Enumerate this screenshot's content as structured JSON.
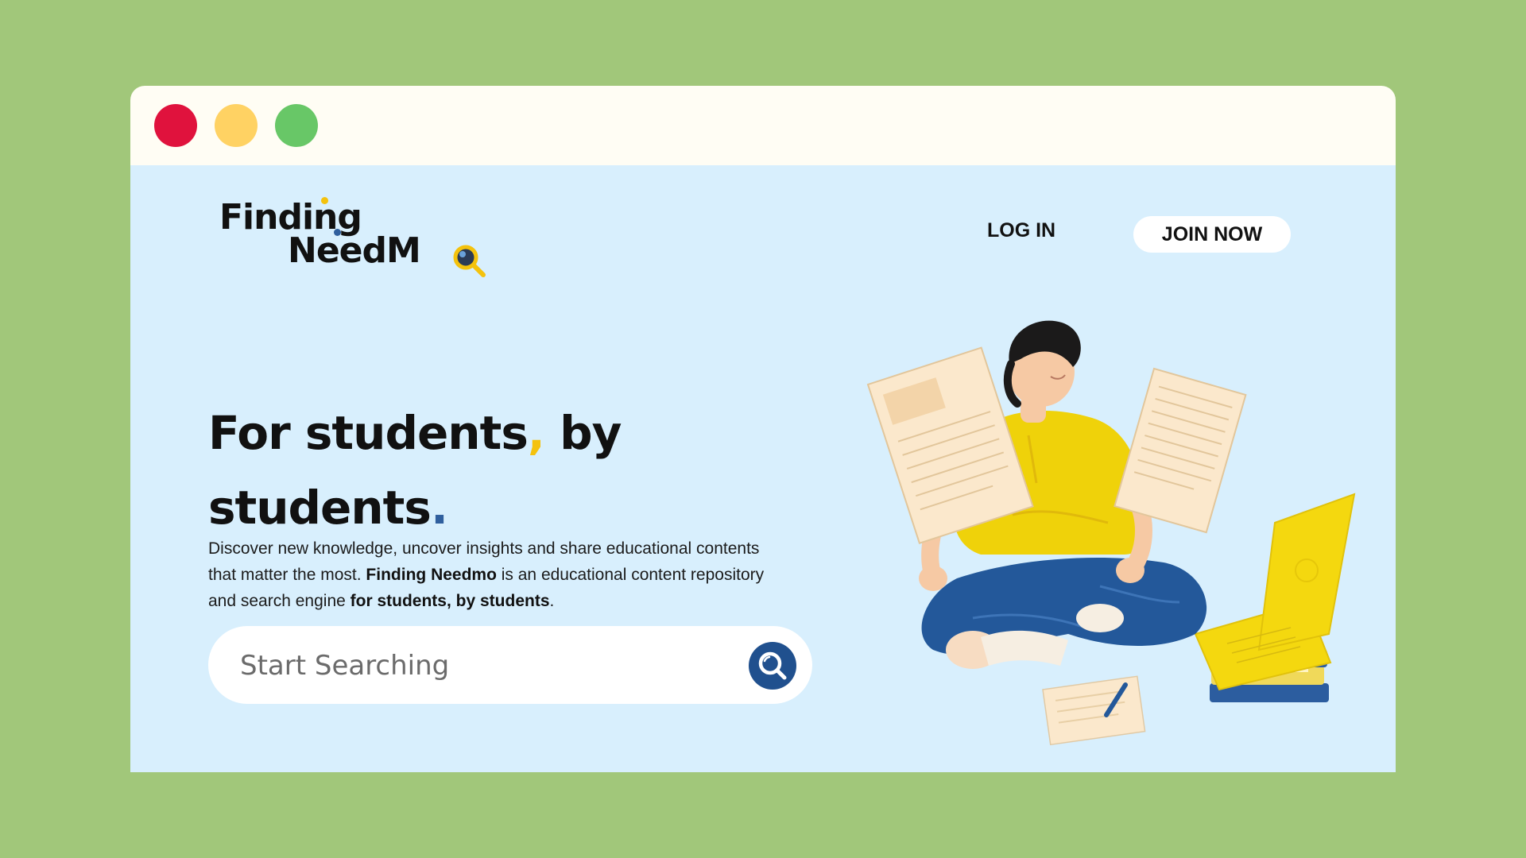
{
  "window": {
    "controls": [
      "close",
      "minimize",
      "maximize"
    ],
    "colors": {
      "close": "#e0123d",
      "minimize": "#ffd263",
      "maximize": "#68c767",
      "titlebar": "#fffdf4",
      "content_bg": "#d8effd",
      "page_bg": "#a1c77a"
    }
  },
  "header": {
    "logo": {
      "line1": "Finding",
      "line2": "NeedM",
      "icon": "magnifier-o-icon"
    },
    "nav": {
      "login": "LOG IN",
      "join": "JOIN NOW"
    }
  },
  "hero": {
    "headline_part1": "For students",
    "headline_comma": ",",
    "headline_part2": " by",
    "headline_part3": "students",
    "headline_period": ".",
    "description": {
      "p1": "Discover new knowledge, uncover insights and share educational contents that matter the most. ",
      "brand": "Finding Needmo",
      "p2": " is an educational content repository and search engine ",
      "tagline": "for students, by students",
      "p3": "."
    },
    "accent_colors": {
      "yellow": "#f4c20d",
      "blue": "#2f5f9e"
    }
  },
  "search": {
    "placeholder": "Start Searching",
    "value": "",
    "icon": "search-icon",
    "button_color": "#20508e"
  },
  "illustration": {
    "icon": "student-reading-illustration",
    "colors": {
      "shirt": "#efd20a",
      "pants": "#23589a",
      "paper": "#fbe8cc",
      "laptop": "#f4d80f",
      "books": "#2c5d9f",
      "hair": "#1b1a1a",
      "skin": "#f6c9a4"
    }
  }
}
